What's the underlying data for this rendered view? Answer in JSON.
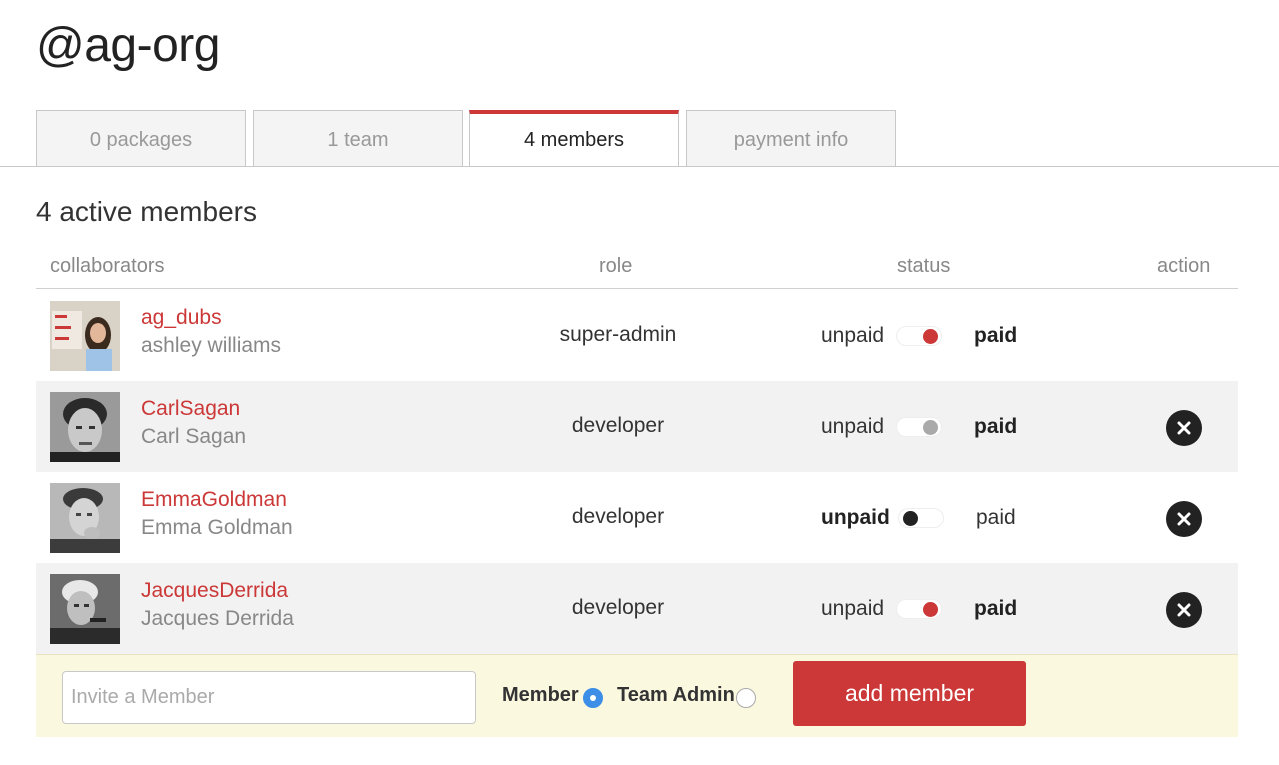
{
  "org": {
    "title": "@ag-org"
  },
  "tabs": [
    {
      "label": "0 packages",
      "active": false
    },
    {
      "label": "1 team",
      "active": false
    },
    {
      "label": "4 members",
      "active": true
    },
    {
      "label": "payment info",
      "active": false
    }
  ],
  "section": {
    "title": "4 active members"
  },
  "table": {
    "headers": {
      "collaborators": "collaborators",
      "role": "role",
      "status": "status",
      "action": "action"
    },
    "rows": [
      {
        "username": "ag_dubs",
        "fullname": "ashley williams",
        "role": "super-admin",
        "unpaid": "unpaid",
        "paid": "paid",
        "status": "paid",
        "toggle_color": "#cb3837",
        "removable": false
      },
      {
        "username": "CarlSagan",
        "fullname": "Carl Sagan",
        "role": "developer",
        "unpaid": "unpaid",
        "paid": "paid",
        "status": "paid",
        "toggle_color": "#aaaaaa",
        "removable": true
      },
      {
        "username": "EmmaGoldman",
        "fullname": "Emma Goldman",
        "role": "developer",
        "unpaid": "unpaid",
        "paid": "paid",
        "status": "unpaid",
        "toggle_color": "#222222",
        "removable": true
      },
      {
        "username": "JacquesDerrida",
        "fullname": "Jacques Derrida",
        "role": "developer",
        "unpaid": "unpaid",
        "paid": "paid",
        "status": "paid",
        "toggle_color": "#cb3837",
        "removable": true
      }
    ]
  },
  "invite": {
    "placeholder": "Invite a Member",
    "value": "",
    "member_label": "Member",
    "team_admin_label": "Team Admin",
    "selected_role": "Member",
    "add_label": "add member"
  },
  "colors": {
    "accent": "#cb3837",
    "radio_selected": "#3d8ee6",
    "invite_bg": "#fbf8e0"
  }
}
